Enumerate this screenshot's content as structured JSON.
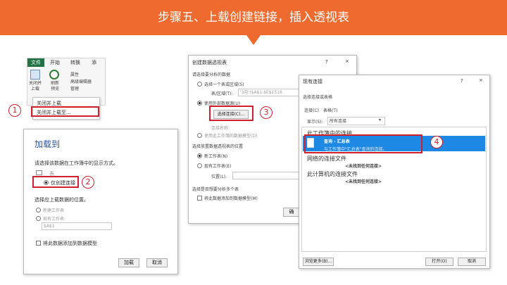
{
  "banner": {
    "title": "步骤五、上载创建链接，插入透视表"
  },
  "ribbon": {
    "tabs": [
      "文件",
      "开始",
      "转换",
      "添"
    ],
    "close_load_label": "关闭并\n上载",
    "refresh_label": "刷新\n预览",
    "properties_label": "属性",
    "advanced_editor_label": "高级编辑器",
    "manage_label": "管理",
    "menu_items": [
      "关闭并上载",
      "关闭并上载至..."
    ]
  },
  "load_to": {
    "title": "加载到",
    "instruction": "请选择该数据在工作簿中的显示方式。",
    "options": [
      "表",
      "仅创建连接"
    ],
    "location_label": "选择应上载数据的位置。",
    "location_options": [
      "新建工作表",
      "现有工作表:"
    ],
    "cell_value": "$A$1",
    "model_checkbox": "将此数据添加到数据模型",
    "load_button": "加载",
    "cancel_button": "取消"
  },
  "pivot": {
    "title": "创建数据透视表",
    "help": "?",
    "close": "×",
    "section1": "请选择要分析的数据",
    "option_range": "选择一个表或区域(S)",
    "range_label": "表/区域(T):",
    "range_value": "'3月'!$A$1:$E$1516",
    "option_external": "使用外部数据源(U)",
    "choose_conn_button": "选择连接(C)...",
    "conn_name_label": "连接名称:",
    "option_model": "使用此工作簿的数据模型(D)",
    "section2": "选择放置数据透视表的位置",
    "new_sheet": "新工作表(N)",
    "existing_sheet": "现有工作表(E)",
    "position_label": "位置(L):",
    "section3": "选择是否想要分析多个表",
    "model_checkbox": "将此数据添加到数据模型(M)",
    "ok_partial": "确"
  },
  "existing": {
    "title": "现有连接",
    "help": "?",
    "close": "×",
    "select_label": "选择连接或表格",
    "tabs": [
      "连接(C)",
      "表格(T)"
    ],
    "show_label": "显示(S):",
    "show_value": "所有连接",
    "group1": "此工作簿中的连接",
    "conn_name": "查询 - 汇总表",
    "conn_desc": "与工作簿中\"汇总表\"查询的连接。",
    "group2": "网络的连接文件",
    "none1": "<未找到任何连接>",
    "group3": "此计算机的连接文件",
    "none2": "<未找到任何连接>",
    "browse_button": "浏览更多(B)...",
    "open_button": "打开(O)",
    "cancel_button": "取消"
  },
  "callouts": [
    "1",
    "2",
    "3",
    "4"
  ],
  "colors": {
    "banner": "#ef6a2e",
    "highlight": "#1e88e5",
    "callout": "#d0202c",
    "file_tab": "#217346"
  }
}
